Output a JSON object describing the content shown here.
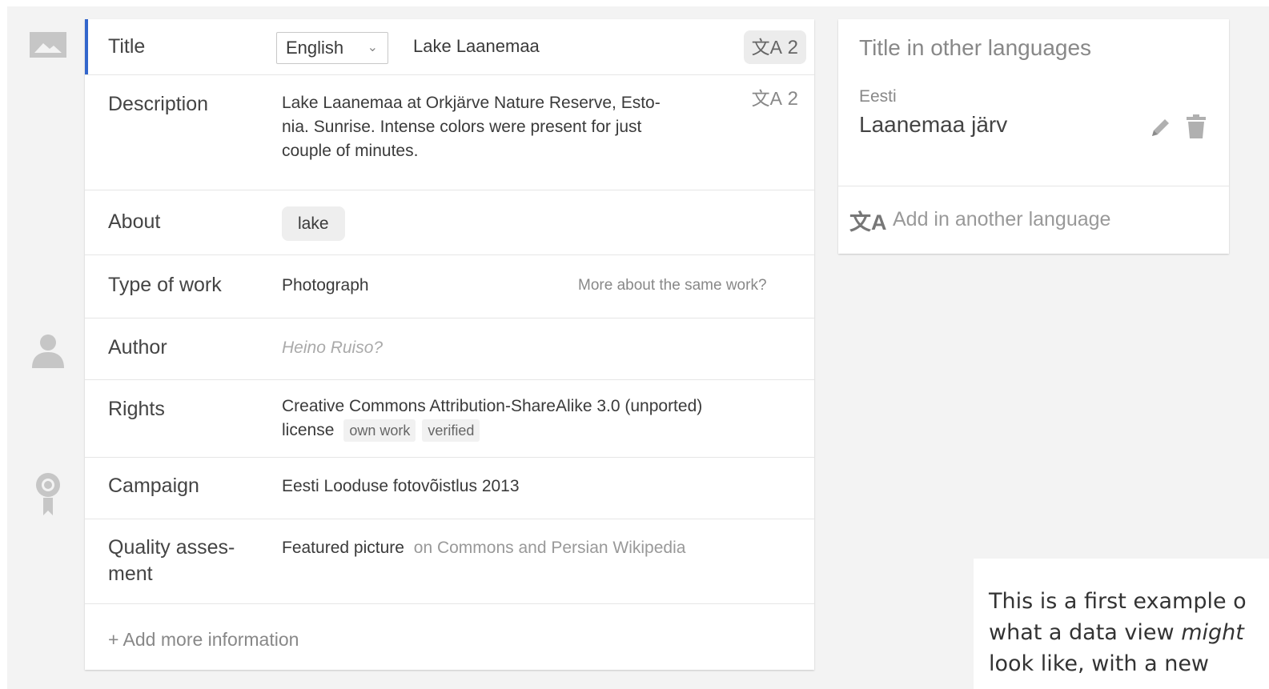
{
  "icons": {
    "image": "image-icon",
    "person": "person-icon",
    "award": "award-icon",
    "translate": "translate-icon",
    "chevron": "chevron-down-icon",
    "edit": "pencil-icon",
    "delete": "trash-icon"
  },
  "colors": {
    "accent": "#3366cc",
    "background": "#f3f3f3",
    "card": "#ffffff"
  },
  "title_row": {
    "label": "Title",
    "language_select": "English",
    "value": "Lake Laanemaa",
    "translation_count": "2"
  },
  "description_row": {
    "label": "Description",
    "lines": [
      "Lake Laanemaa at Orkjärve Nature Reserve, Esto-",
      "nia. Sunrise. Intense colors were present for just",
      "couple of minutes."
    ],
    "translation_count": "2"
  },
  "about_row": {
    "label": "About",
    "tag": "lake"
  },
  "type_row": {
    "label": "Type of work",
    "value": "Photograph",
    "link": "More about the same work?"
  },
  "author_row": {
    "label": "Author",
    "value": "Heino Ruiso?"
  },
  "rights_row": {
    "label": "Rights",
    "line1": "Creative Commons Attribution-ShareAlike 3.0 (unported)",
    "line2": "license",
    "tags": [
      "own work",
      "verified"
    ]
  },
  "campaign_row": {
    "label": "Campaign",
    "value": "Eesti Looduse fotovõistlus 2013"
  },
  "quality_row": {
    "label_line1": "Quality asses-",
    "label_line2": "ment",
    "value": "Featured picture",
    "context": "on Commons and Persian Wikipedia"
  },
  "add_more": "+ Add more information",
  "side_panel": {
    "title": "Title in other languages",
    "language": "Eesti",
    "value": "Laanemaa järv",
    "add_language": "Add in another language"
  },
  "note": {
    "line1": "This is a first example o",
    "line2_before": "what a data view ",
    "line2_em": "might",
    "line3": "look like, with a new"
  }
}
